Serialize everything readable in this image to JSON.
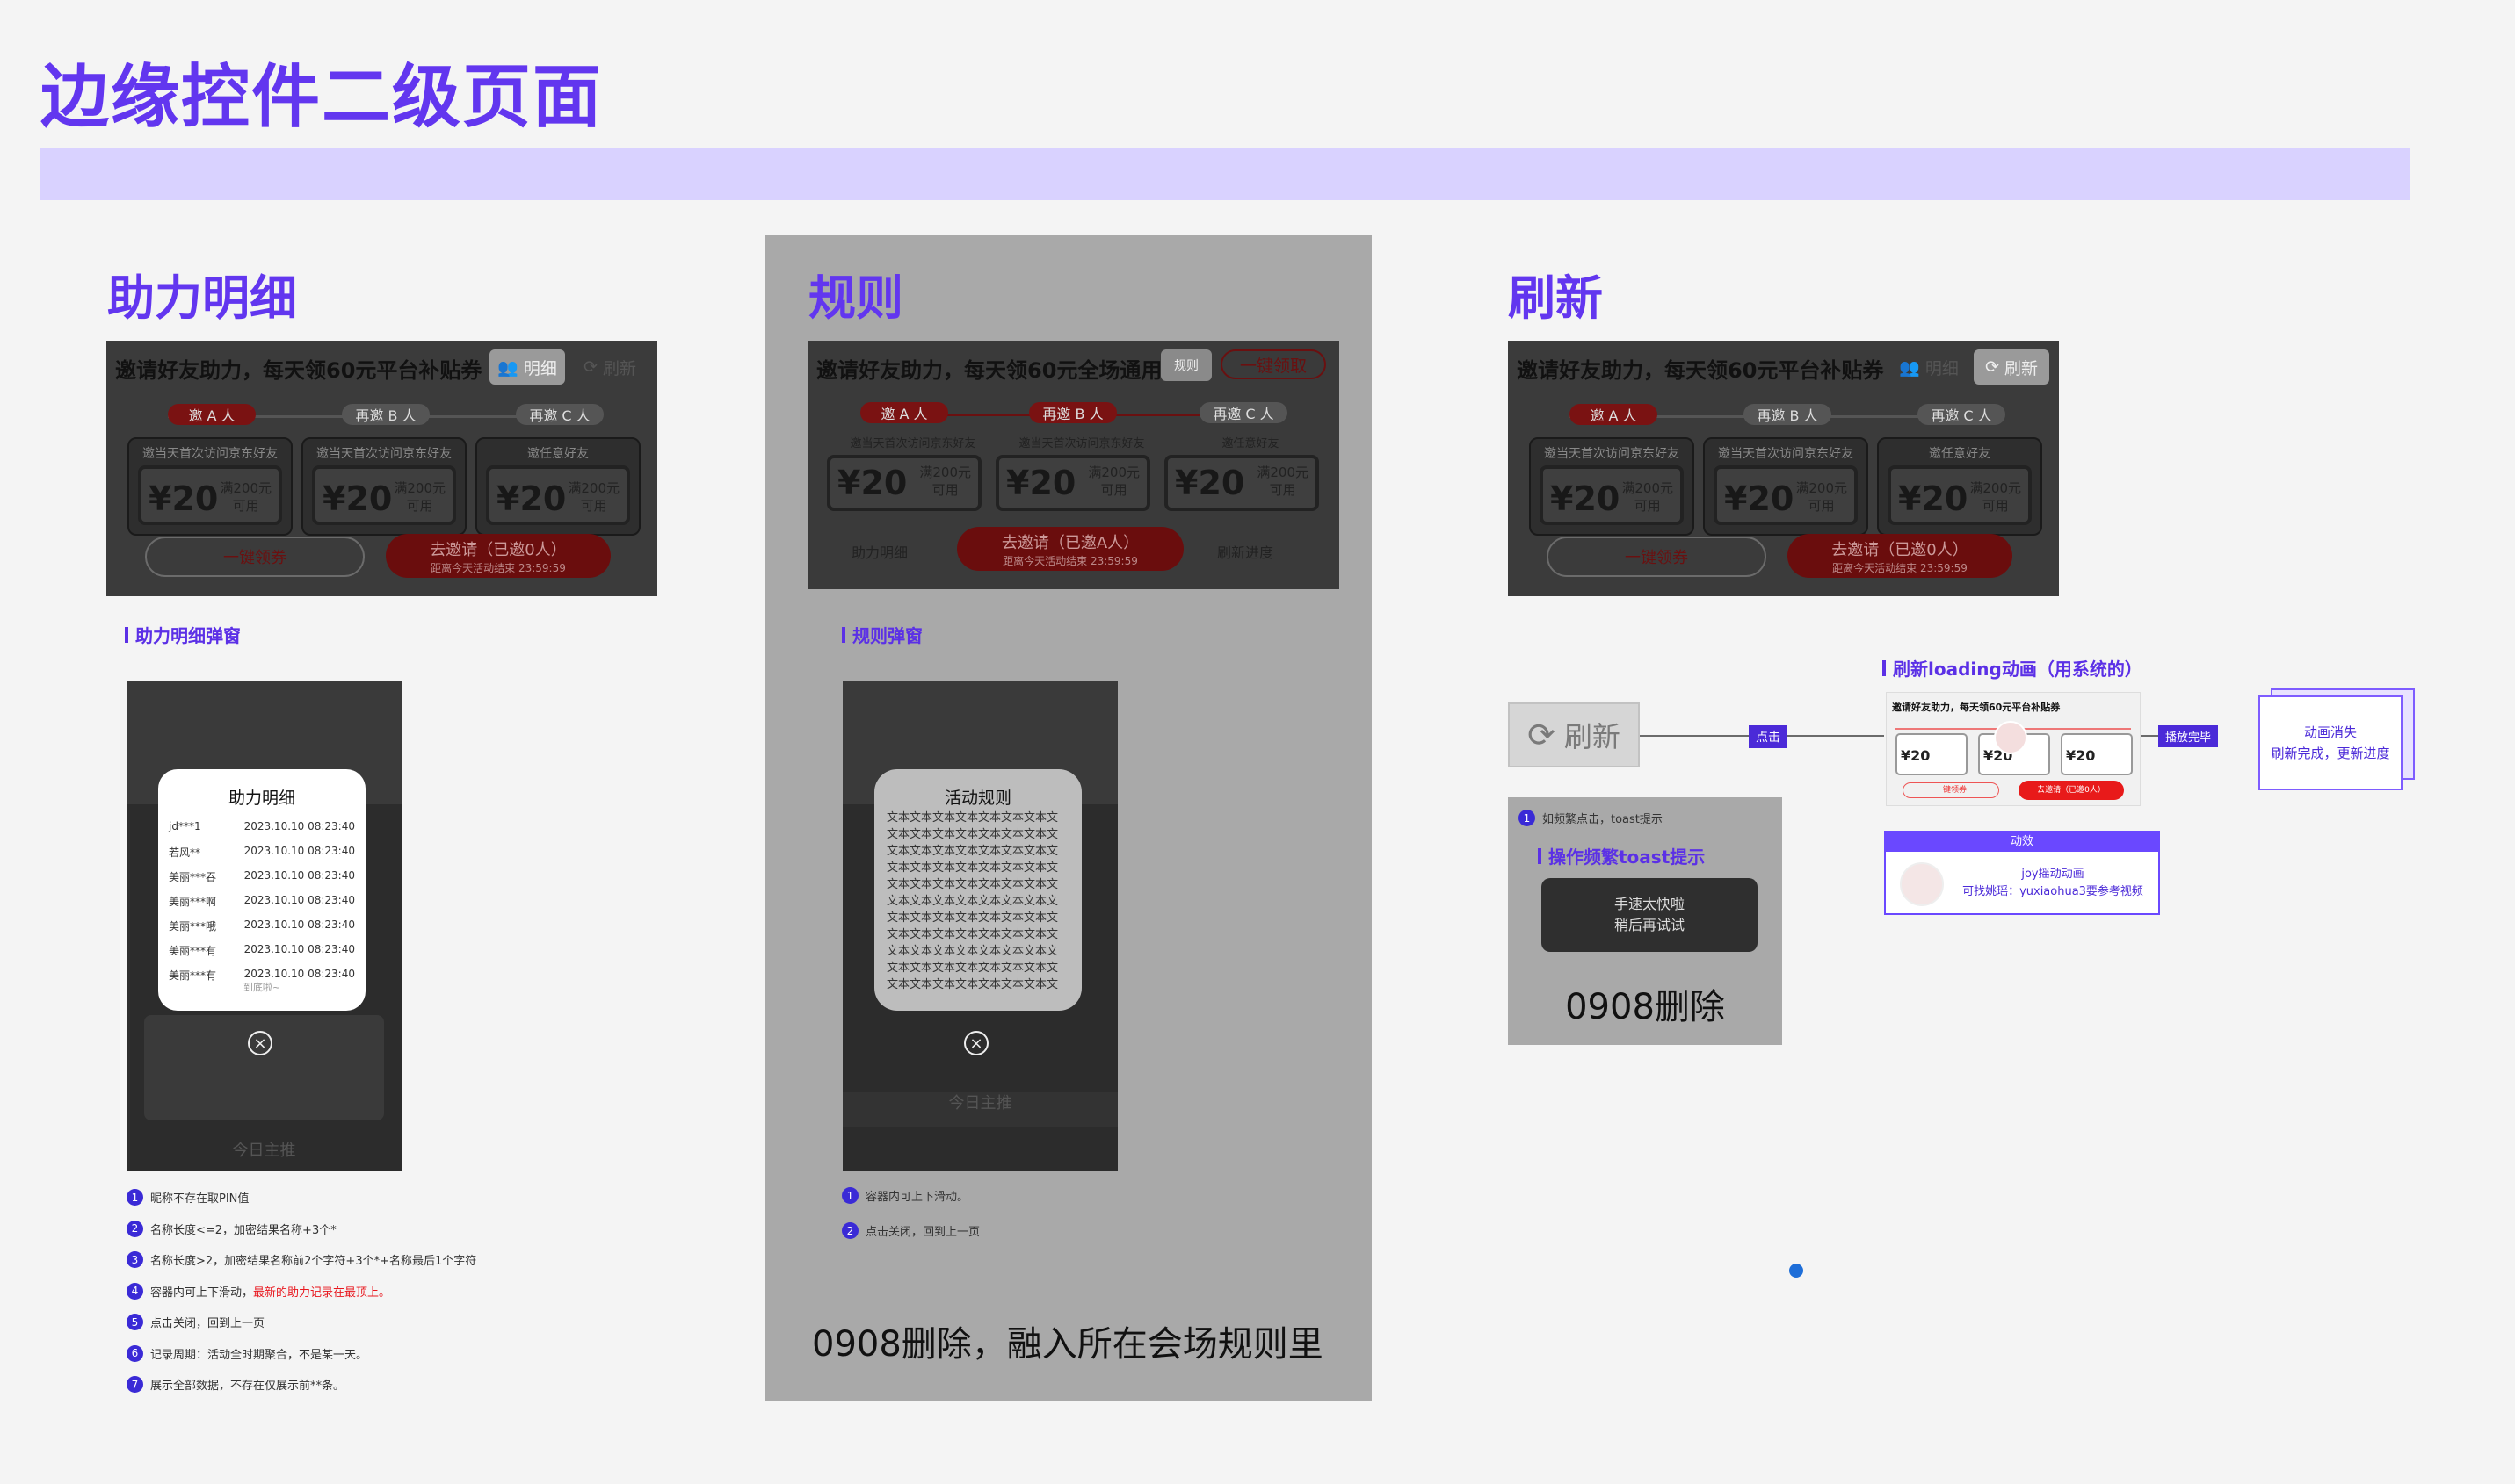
{
  "page_title": "边缘控件二级页面",
  "sections": {
    "s1_title": "助力明细",
    "s2_title": "规则",
    "s3_title": "刷新"
  },
  "banner": {
    "title1": "邀请好友助力，每天领60元平台补贴券",
    "title2": "邀请好友助力，每天领60元全场通用券",
    "btn_detail": "明细",
    "btn_rules": "规则",
    "btn_refresh": "刷新",
    "btn_receive": "一键领取",
    "steps": [
      "邀 A 人",
      "再邀 B 人",
      "再邀 C 人"
    ],
    "card_caps1": [
      "邀当天首次访问京东好友",
      "邀当天首次访问京东好友",
      "邀任意好友"
    ],
    "card_caps2": [
      "邀当天首次访问京东好友",
      "邀当天首次访问京东好友",
      "邀任意好友"
    ],
    "amount": "¥20",
    "cond": [
      "满200元",
      "可用"
    ],
    "claim_all": "一键领券",
    "go_invite": "去邀请（已邀0人）",
    "go_invite_sub": "距离今天活动结束 23:59:59",
    "go_invite2": "去邀请（已邀A人）",
    "help_detail": "助力明细",
    "refresh_progress": "刷新进度"
  },
  "s1": {
    "sublabel": "助力明细弹窗",
    "modal_title": "助力明细",
    "records": [
      {
        "name": "jd***1",
        "time": "2023.10.10 08:23:40"
      },
      {
        "name": "若风**",
        "time": "2023.10.10 08:23:40"
      },
      {
        "name": "美丽***吞",
        "time": "2023.10.10 08:23:40"
      },
      {
        "name": "美丽***啊",
        "time": "2023.10.10 08:23:40"
      },
      {
        "name": "美丽***哦",
        "time": "2023.10.10 08:23:40"
      },
      {
        "name": "美丽***有",
        "time": "2023.10.10 08:23:40"
      },
      {
        "name": "美丽***有",
        "time": "2023.10.10 08:23:40"
      }
    ],
    "end_text": "到底啦~",
    "phone_header": "今日主推",
    "notes": [
      {
        "n": "1",
        "text": "昵称不存在取PIN值",
        "hl": ""
      },
      {
        "n": "2",
        "text": "名称长度<=2，加密结果名称+3个*",
        "hl": ""
      },
      {
        "n": "3",
        "text": "名称长度>2，加密结果名称前2个字符+3个*+名称最后1个字符",
        "hl": ""
      },
      {
        "n": "4",
        "text": "容器内可上下滑动，",
        "hl": "最新的助力记录在最顶上。"
      },
      {
        "n": "5",
        "text": "点击关闭，回到上一页",
        "hl": ""
      },
      {
        "n": "6",
        "text": "记录周期：活动全时期聚合，不是某一天。",
        "hl": ""
      },
      {
        "n": "7",
        "text": "展示全部数据，不存在仅展示前**条。",
        "hl": ""
      }
    ]
  },
  "s2": {
    "sublabel": "规则弹窗",
    "modal_title": "活动规则",
    "rule_line": "文本文本文本文本文本文本文本文",
    "notes": [
      {
        "n": "1",
        "text": "容器内可上下滑动。"
      },
      {
        "n": "2",
        "text": "点击关闭，回到上一页"
      }
    ],
    "footer": "0908删除，融入所在会场规则里"
  },
  "s3": {
    "refresh_label": "刷新",
    "click_label": "点击",
    "done_label": "播放完毕",
    "loading_sublabel": "刷新loading动画（用系统的）",
    "result_line1": "动画消失",
    "result_line2": "刷新完成，更新进度",
    "effect_title": "动效",
    "effect_line1": "joy摇动动画",
    "effect_line2": "可找姚瑶：yuxiaohua3要参考视频",
    "toast_note": "如频繁点击，toast提示",
    "toast_sublabel": "操作频繁toast提示",
    "toast_line1": "手速太快啦",
    "toast_line2": "稍后再试试",
    "deleted": "0908删除"
  },
  "colors": {
    "accent": "#6236ef",
    "band": "#d9d2ff",
    "highlight_red": "#e8171e"
  }
}
